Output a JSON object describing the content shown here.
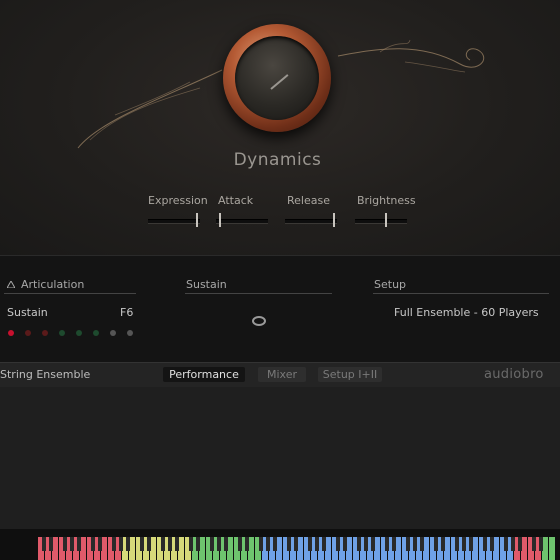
{
  "header": {
    "title": "Dynamics",
    "sliders": [
      {
        "label": "Expression",
        "value": 0.95
      },
      {
        "label": "Attack",
        "value": 0.05
      },
      {
        "label": "Release",
        "value": 0.95
      },
      {
        "label": "Brightness",
        "value": 0.6
      }
    ]
  },
  "articulation": {
    "heading": "Articulation",
    "name": "Sustain",
    "key": "F6",
    "dot_colors": [
      "#c8102e",
      "#5a1a1a",
      "#5a1a1a",
      "#1e4a2e",
      "#1e4a2e",
      "#1e4a2e",
      "#555555",
      "#555555"
    ]
  },
  "sustain": {
    "heading": "Sustain"
  },
  "setup": {
    "heading": "Setup",
    "value": "Full Ensemble - 60 Players"
  },
  "tabbar": {
    "instrument": "String Ensemble",
    "tabs": [
      "Performance",
      "Mixer",
      "Setup I+II"
    ],
    "active_tab": "Performance",
    "brand": "audiobro"
  },
  "keyboard": {
    "zone_colors": [
      "#e05a6a",
      "#d6d97a",
      "#6ec46e",
      "#6fa1e6",
      "#e05a6a",
      "#6ec46e"
    ]
  }
}
